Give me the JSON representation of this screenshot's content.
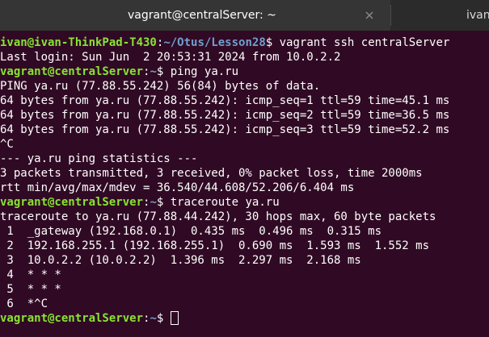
{
  "window": {
    "active_tab_title": "vagrant@centralServer: ~",
    "inactive_tab_title": "ivan",
    "close_icon": "close-icon"
  },
  "lines": [
    {
      "user": "ivan@ivan-ThinkPad-T430",
      "path": "~/Otus/Lesson28",
      "symbol": "$",
      "cmd": " vagrant ssh centralServer"
    },
    {
      "text": "Last login: Sun Jun  2 20:53:31 2024 from 10.0.2.2"
    },
    {
      "user": "vagrant@centralServer",
      "path": "~",
      "symbol": "$",
      "cmd": " ping ya.ru"
    },
    {
      "text": "PING ya.ru (77.88.55.242) 56(84) bytes of data."
    },
    {
      "text": "64 bytes from ya.ru (77.88.55.242): icmp_seq=1 ttl=59 time=45.1 ms"
    },
    {
      "text": "64 bytes from ya.ru (77.88.55.242): icmp_seq=2 ttl=59 time=36.5 ms"
    },
    {
      "text": "64 bytes from ya.ru (77.88.55.242): icmp_seq=3 ttl=59 time=52.2 ms"
    },
    {
      "text": "^C"
    },
    {
      "text": "--- ya.ru ping statistics ---"
    },
    {
      "text": "3 packets transmitted, 3 received, 0% packet loss, time 2000ms"
    },
    {
      "text": "rtt min/avg/max/mdev = 36.540/44.608/52.206/6.404 ms"
    },
    {
      "user": "vagrant@centralServer",
      "path": "~",
      "symbol": "$",
      "cmd": " traceroute ya.ru"
    },
    {
      "text": "traceroute to ya.ru (77.88.44.242), 30 hops max, 60 byte packets"
    },
    {
      "text": " 1  _gateway (192.168.0.1)  0.435 ms  0.496 ms  0.315 ms"
    },
    {
      "text": " 2  192.168.255.1 (192.168.255.1)  0.690 ms  1.593 ms  1.552 ms"
    },
    {
      "text": " 3  10.0.2.2 (10.0.2.2)  1.396 ms  2.297 ms  2.168 ms"
    },
    {
      "text": " 4  * * *"
    },
    {
      "text": " 5  * * *"
    },
    {
      "text": " 6  *^C"
    },
    {
      "user": "vagrant@centralServer",
      "path": "~",
      "symbol": "$",
      "cmd": " ",
      "cursor": true
    }
  ],
  "colors": {
    "background": "#300a24",
    "user_host": "#8ae234",
    "path": "#729fcf",
    "text": "#ffffff"
  }
}
